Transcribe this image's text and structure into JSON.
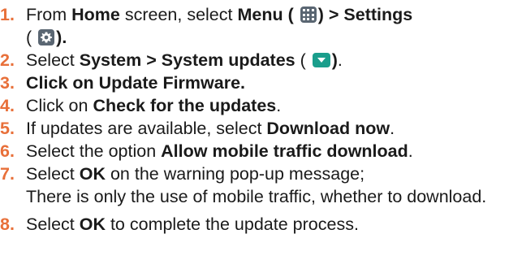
{
  "steps": [
    {
      "num": "1.",
      "prefix": "From ",
      "home": "Home",
      "mid": " screen, select ",
      "menu": "Menu",
      "paren_open": " (",
      "paren_close": ") > Settings",
      "line2_open": "(",
      "line2_close": ").",
      "icons": [
        "menu-icon",
        "gear-icon"
      ]
    },
    {
      "num": "2.",
      "prefix": "Select ",
      "bold": "System > System updates",
      "paren_open": " (",
      "paren_close": ")",
      "suffix": ".",
      "icon": "system-update-icon"
    },
    {
      "num": "3.",
      "bold": "Click on Update Firmware."
    },
    {
      "num": "4.",
      "prefix": "Click on ",
      "bold": "Check for the updates",
      "suffix": "."
    },
    {
      "num": "5.",
      "prefix": "If updates are available, select ",
      "bold": "Download now",
      "suffix": "."
    },
    {
      "num": "6.",
      "prefix": "Select the option ",
      "bold": "Allow mobile traffic download",
      "suffix": "."
    },
    {
      "num": "7.",
      "prefix": "Select ",
      "bold": "OK",
      "suffix": " on the warning pop-up message;",
      "line2": "There is only the use of mobile traffic, whether to download."
    },
    {
      "num": "8.",
      "prefix": "Select ",
      "bold": "OK",
      "suffix": " to complete the update process."
    }
  ],
  "colors": {
    "number": "#e8703a",
    "text": "#1a1a1a",
    "icon_gray": "#5a6672",
    "icon_teal": "#1a9e8c"
  }
}
